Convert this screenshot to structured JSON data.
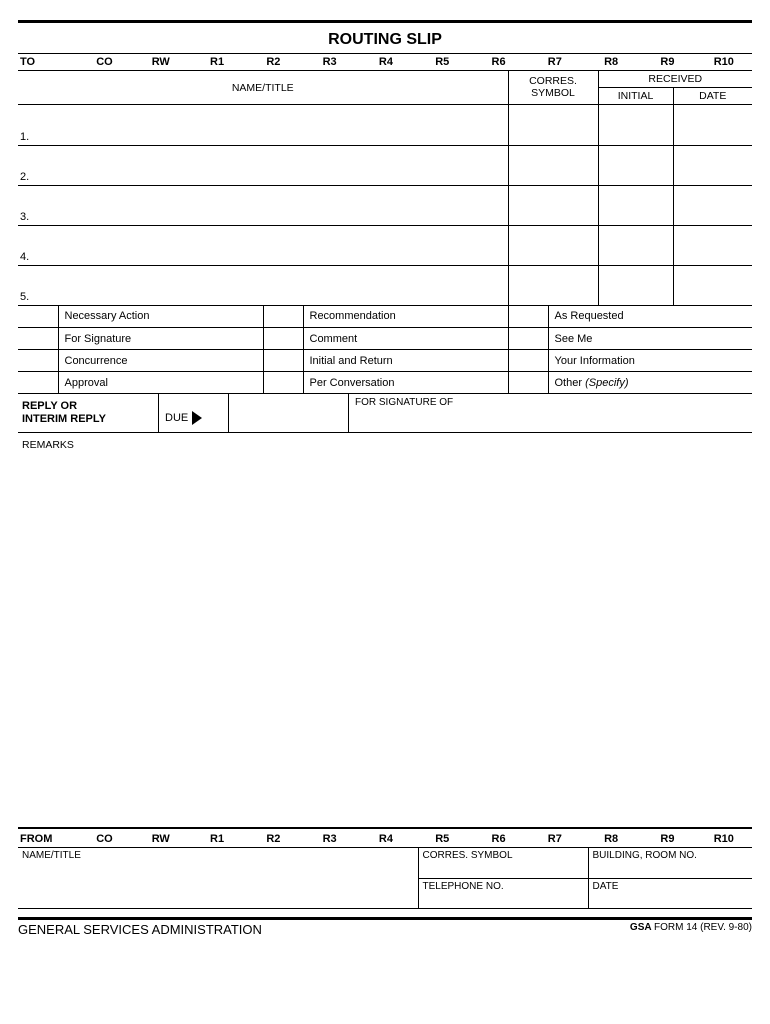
{
  "title": "ROUTING SLIP",
  "top_cols": {
    "to": "TO",
    "co": "CO",
    "rw": "RW",
    "r1": "R1",
    "r2": "R2",
    "r3": "R3",
    "r4": "R4",
    "r5": "R5",
    "r6": "R6",
    "r7": "R7",
    "r8": "R8",
    "r9": "R9",
    "r10": "R10"
  },
  "sub": {
    "name_title": "NAME/TITLE",
    "corres_symbol": "CORRES. SYMBOL",
    "received": "RECEIVED",
    "initial": "INITIAL",
    "date": "DATE"
  },
  "rows": {
    "n1": "1.",
    "n2": "2.",
    "n3": "3.",
    "n4": "4.",
    "n5": "5."
  },
  "chk": {
    "necessary_action": "Necessary Action",
    "for_signature": "For Signature",
    "concurrence": "Concurrence",
    "approval": "Approval",
    "recommendation": "Recommendation",
    "comment": "Comment",
    "initial_return": "Initial and Return",
    "per_conversation": "Per Conversation",
    "as_requested": "As Requested",
    "see_me": "See Me",
    "your_information": "Your Information",
    "other": "Other ",
    "specify": "(Specify)"
  },
  "reply": {
    "line1": "REPLY OR",
    "line2": "INTERIM REPLY",
    "due": "DUE",
    "for_signature_of": "FOR SIGNATURE OF"
  },
  "remarks_label": "REMARKS",
  "from_cols": {
    "from": "FROM",
    "co": "CO",
    "rw": "RW",
    "r1": "R1",
    "r2": "R2",
    "r3": "R3",
    "r4": "R4",
    "r5": "R5",
    "r6": "R6",
    "r7": "R7",
    "r8": "R8",
    "r9": "R9",
    "r10": "R10"
  },
  "from_sub": {
    "name_title": "NAME/TITLE",
    "corres_symbol": "CORRES. SYMBOL",
    "building_room": "BUILDING, ROOM NO.",
    "telephone": "TELEPHONE NO.",
    "date": "DATE"
  },
  "footer": {
    "agency": "GENERAL SERVICES ADMINISTRATION",
    "form_bold": "GSA ",
    "form_rest": "FORM 14 (REV. 9-80)"
  }
}
